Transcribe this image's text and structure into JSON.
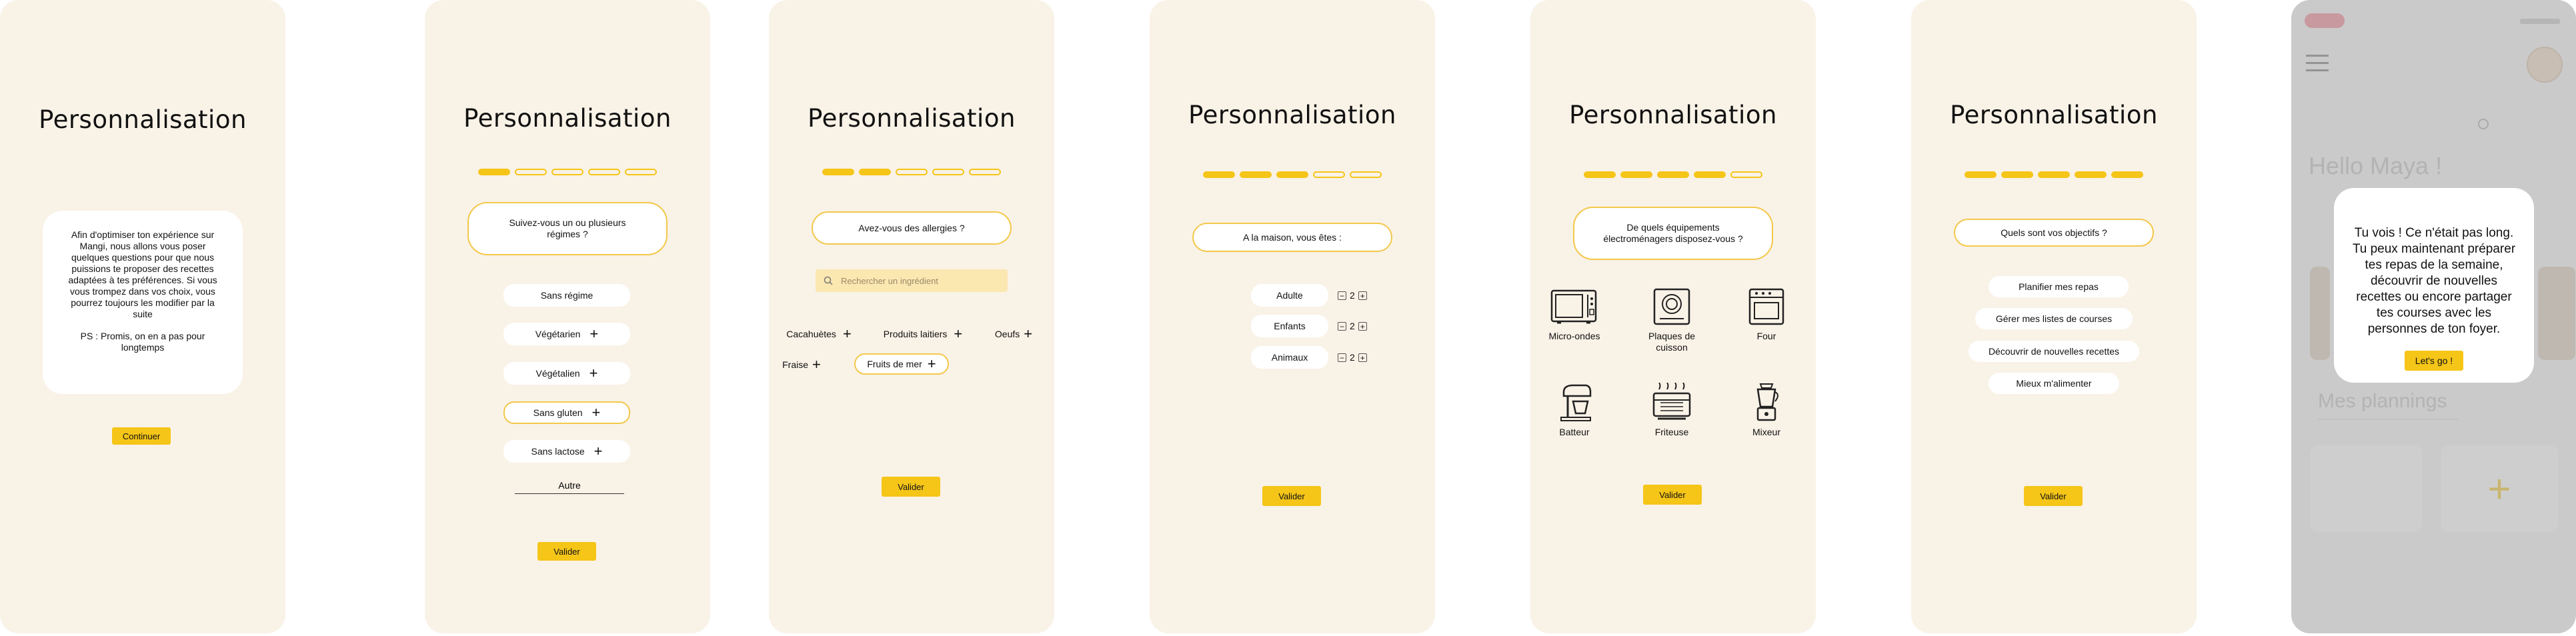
{
  "colors": {
    "background": "#ffffff",
    "screen": "#f9f2e7",
    "accent": "#f5c518",
    "chip": "#ffffff",
    "search_bg": "#fbe7b0"
  },
  "screens": {
    "intro": {
      "title": "Personnalisation",
      "text": "Afin d'optimiser ton expérience sur Mangi, nous allons vous poser quelques questions pour que nous puissions te proposer des recettes adaptées à tes préférences. Si vous vous trompez dans vos choix, vous pourrez toujours les modifier par la suite",
      "ps": "PS : Promis, on en a pas pour longtemps",
      "continue_label": "Continuer"
    },
    "diet": {
      "title": "Personnalisation",
      "progress": {
        "total": 5,
        "filled": 1
      },
      "question": "Suivez-vous un ou plusieurs régimes ?",
      "options": [
        {
          "label": "Sans régime",
          "plus": false,
          "selected": false
        },
        {
          "label": "Végétarien",
          "plus": true,
          "selected": false
        },
        {
          "label": "Végétalien",
          "plus": true,
          "selected": false
        },
        {
          "label": "Sans gluten",
          "plus": true,
          "selected": true
        },
        {
          "label": "Sans lactose",
          "plus": true,
          "selected": false
        }
      ],
      "other_value": "Autre",
      "validate_label": "Valider"
    },
    "allergies": {
      "title": "Personnalisation",
      "progress": {
        "total": 5,
        "filled": 2
      },
      "question": "Avez-vous des allergies ?",
      "search_placeholder": "Rechercher un ingrédient",
      "options": [
        {
          "label": "Cacahuètes",
          "selected": false
        },
        {
          "label": "Produits laitiers",
          "selected": false
        },
        {
          "label": "Oeufs",
          "selected": false
        },
        {
          "label": "Fraise",
          "selected": false
        },
        {
          "label": "Fruits de mer",
          "selected": true
        }
      ],
      "validate_label": "Valider"
    },
    "household": {
      "title": "Personnalisation",
      "progress": {
        "total": 5,
        "filled": 3
      },
      "question": "A la maison, vous êtes :",
      "members": [
        {
          "label": "Adulte",
          "count": "2"
        },
        {
          "label": "Enfants",
          "count": "2"
        },
        {
          "label": "Animaux",
          "count": "2"
        }
      ],
      "minus": "−",
      "plus": "+",
      "validate_label": "Valider"
    },
    "appliances": {
      "title": "Personnalisation",
      "progress": {
        "total": 5,
        "filled": 4
      },
      "question": "De quels équipements électroménagers disposez-vous ?",
      "items": [
        {
          "label": "Micro-ondes",
          "icon": "microwave-icon"
        },
        {
          "label": "Plaques de cuisson",
          "icon": "cooktop-icon"
        },
        {
          "label": "Four",
          "icon": "oven-icon"
        },
        {
          "label": "Batteur",
          "icon": "stand-mixer-icon"
        },
        {
          "label": "Friteuse",
          "icon": "fryer-icon"
        },
        {
          "label": "Mixeur",
          "icon": "blender-icon"
        }
      ],
      "validate_label": "Valider"
    },
    "goals": {
      "title": "Personnalisation",
      "progress": {
        "total": 5,
        "filled": 5
      },
      "question": "Quels sont vos objectifs ?",
      "options": [
        "Planifier mes repas",
        "Gérer mes listes de courses",
        "Découvrir de nouvelles recettes",
        "Mieux m'alimenter"
      ],
      "validate_label": "Valider"
    },
    "home": {
      "greeting": "Hello Maya !",
      "plannings_title": "Mes plannings",
      "add_symbol": "+",
      "popup_text": "Tu vois ! Ce n'était pas long. Tu peux maintenant préparer tes repas de la semaine, découvrir de nouvelles recettes ou encore partager tes courses avec les personnes de ton foyer.",
      "popup_button": "Let's go !"
    }
  }
}
